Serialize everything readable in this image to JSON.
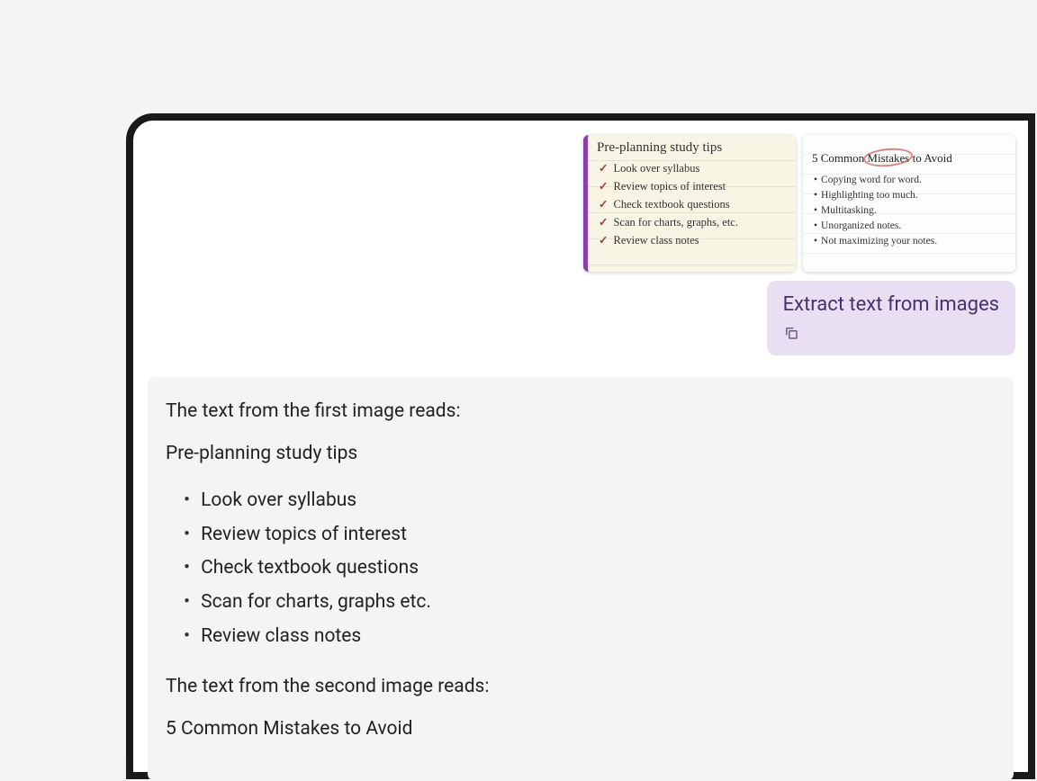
{
  "attachments": {
    "note1": {
      "title": "Pre-planning study tips",
      "items": [
        "Look over syllabus",
        "Review topics of interest",
        "Check textbook questions",
        "Scan for charts, graphs, etc.",
        "Review class notes"
      ]
    },
    "note2": {
      "title_pre": "5 Common ",
      "title_circled": "Mistakes",
      "title_post": " to Avoid",
      "items": [
        "Copying word for word.",
        "Highlighting too much.",
        "Multitasking.",
        "Unorganized notes.",
        "Not maximizing your notes."
      ]
    }
  },
  "user_message": "Extract text from images",
  "ai_response": {
    "intro1": "The text from the first image reads:",
    "heading1": "Pre-planning study tips",
    "list1": [
      "Look over syllabus",
      "Review topics of interest",
      "Check textbook questions",
      "Scan for charts, graphs etc.",
      "Review class notes"
    ],
    "intro2": "The text from the second image reads:",
    "heading2": "5 Common Mistakes to Avoid"
  }
}
